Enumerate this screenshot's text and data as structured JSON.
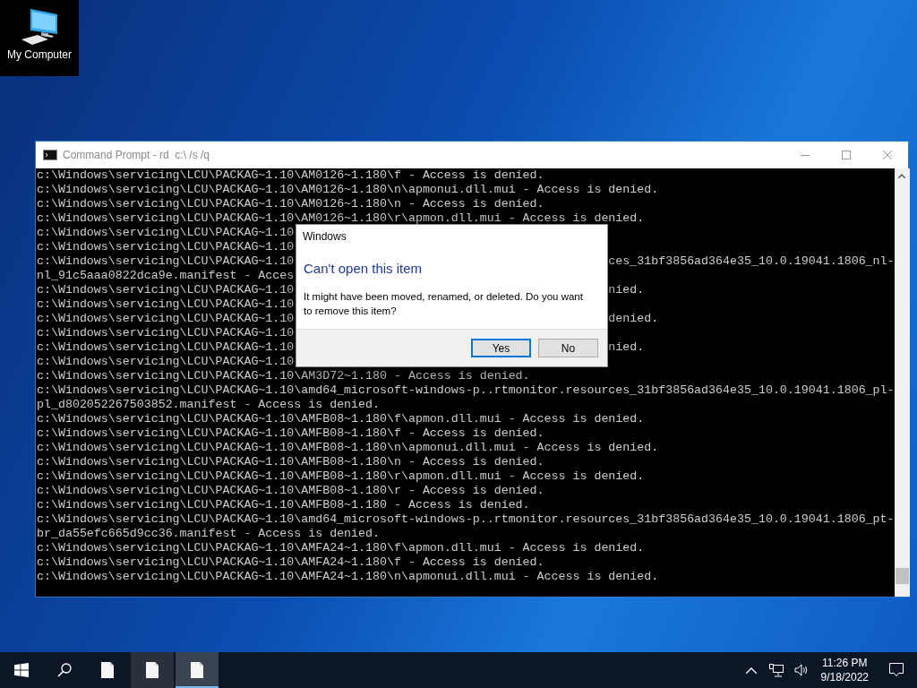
{
  "desktop": {
    "icons": [
      {
        "label": "My Computer",
        "selected": true
      }
    ]
  },
  "console": {
    "title": "Command Prompt - rd  c:\\ /s /q",
    "lines": [
      {
        "text": "c:\\Windows\\servicing\\LCU\\PACKAG~1.10\\AM0126~1.180\\f - Access is denied."
      },
      {
        "text": "c:\\Windows\\servicing\\LCU\\PACKAG~1.10\\AM0126~1.180\\n\\apmonui.dll.mui - Access is denied."
      },
      {
        "text": "c:\\Windows\\servicing\\LCU\\PACKAG~1.10\\AM0126~1.180\\n - Access is denied."
      },
      {
        "text": "c:\\Windows\\servicing\\LCU\\PACKAG~1.10\\AM0126~1.180\\r\\apmon.dll.mui - Access is denied."
      },
      {
        "text": "c:\\Windows\\servicing\\LCU\\PACKAG~1.10"
      },
      {
        "text": "c:\\Windows\\servicing\\LCU\\PACKAG~1.10"
      },
      {
        "text": "c:\\Windows\\servicing\\LCU\\PACKAG~1.10",
        "right": "ces_31bf3856ad364e35_10.0.19041.1806_nl-"
      },
      {
        "text": "nl_91c5aaa0822dca9e.manifest - Acces"
      },
      {
        "text": "c:\\Windows\\servicing\\LCU\\PACKAG~1.10",
        "right": "nied."
      },
      {
        "text": "c:\\Windows\\servicing\\LCU\\PACKAG~1.10"
      },
      {
        "text": "c:\\Windows\\servicing\\LCU\\PACKAG~1.10",
        "right": "denied."
      },
      {
        "text": "c:\\Windows\\servicing\\LCU\\PACKAG~1.10"
      },
      {
        "text": "c:\\Windows\\servicing\\LCU\\PACKAG~1.10",
        "right": "nied."
      },
      {
        "text": "c:\\Windows\\servicing\\LCU\\PACKAG~1.10"
      },
      {
        "text": "c:\\Windows\\servicing\\LCU\\PACKAG~1.10\\AM3D72~1.180 - Access is denied."
      },
      {
        "text": "c:\\Windows\\servicing\\LCU\\PACKAG~1.10\\amd64_microsoft-windows-p..rtmonitor.resources_31bf3856ad364e35_10.0.19041.1806_pl-"
      },
      {
        "text": "pl_d802052267503852.manifest - Access is denied."
      },
      {
        "text": "c:\\Windows\\servicing\\LCU\\PACKAG~1.10\\AMFB08~1.180\\f\\apmon.dll.mui - Access is denied."
      },
      {
        "text": "c:\\Windows\\servicing\\LCU\\PACKAG~1.10\\AMFB08~1.180\\f - Access is denied."
      },
      {
        "text": "c:\\Windows\\servicing\\LCU\\PACKAG~1.10\\AMFB08~1.180\\n\\apmonui.dll.mui - Access is denied."
      },
      {
        "text": "c:\\Windows\\servicing\\LCU\\PACKAG~1.10\\AMFB08~1.180\\n - Access is denied."
      },
      {
        "text": "c:\\Windows\\servicing\\LCU\\PACKAG~1.10\\AMFB08~1.180\\r\\apmon.dll.mui - Access is denied."
      },
      {
        "text": "c:\\Windows\\servicing\\LCU\\PACKAG~1.10\\AMFB08~1.180\\r - Access is denied."
      },
      {
        "text": "c:\\Windows\\servicing\\LCU\\PACKAG~1.10\\AMFB08~1.180 - Access is denied."
      },
      {
        "text": "c:\\Windows\\servicing\\LCU\\PACKAG~1.10\\amd64_microsoft-windows-p..rtmonitor.resources_31bf3856ad364e35_10.0.19041.1806_pt-"
      },
      {
        "text": "br_da55efc665d9cc36.manifest - Access is denied."
      },
      {
        "text": "c:\\Windows\\servicing\\LCU\\PACKAG~1.10\\AMFA24~1.180\\f\\apmon.dll.mui - Access is denied."
      },
      {
        "text": "c:\\Windows\\servicing\\LCU\\PACKAG~1.10\\AMFA24~1.180\\f - Access is denied."
      },
      {
        "text": "c:\\Windows\\servicing\\LCU\\PACKAG~1.10\\AMFA24~1.180\\n\\apmonui.dll.mui - Access is denied."
      }
    ]
  },
  "dialog": {
    "caption": "Windows",
    "heading": "Can't open this item",
    "message": "It might have been moved, renamed, or deleted. Do you want to remove this item?",
    "buttons": [
      {
        "label": "Yes",
        "selected": true
      },
      {
        "label": "No",
        "selected": false
      }
    ]
  },
  "taskbar": {
    "apps": [
      {
        "running": false,
        "active": false
      },
      {
        "running": true,
        "active": false
      },
      {
        "running": true,
        "active": true
      }
    ],
    "time": "11:26 PM",
    "date": "9/18/2022"
  }
}
